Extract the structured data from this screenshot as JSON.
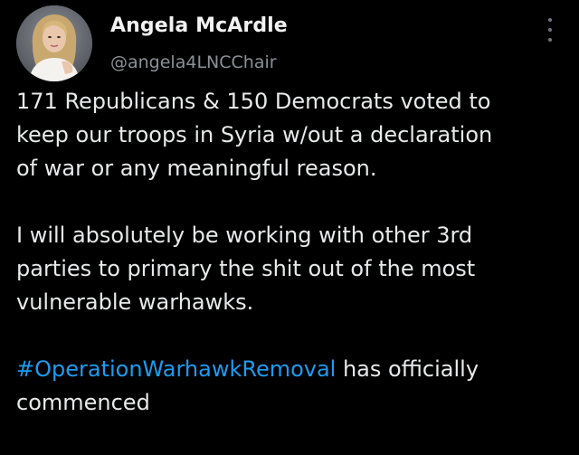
{
  "author": {
    "display_name": "Angela McArdle",
    "handle": "@angela4LNCChair",
    "avatar_icon": "profile-photo"
  },
  "menu": {
    "icon": "more-vertical-icon"
  },
  "tweet": {
    "paragraph_1": [
      "171 Republicans & 150 Democrats voted to",
      "keep our troops in Syria w/out a declaration",
      "of war or any meaningful reason."
    ],
    "paragraph_2": [
      "I will absolutely be working with other 3rd",
      "parties to primary the shit out of the most",
      "vulnerable warhawks."
    ],
    "hashtag": "#OperationWarhawkRemoval",
    "paragraph_3_rest_line1": " has officially",
    "paragraph_3_line2": "commenced"
  },
  "colors": {
    "background": "#000000",
    "text": "#e7e9ea",
    "secondary": "#8b9097",
    "link": "#1d9bf0"
  }
}
